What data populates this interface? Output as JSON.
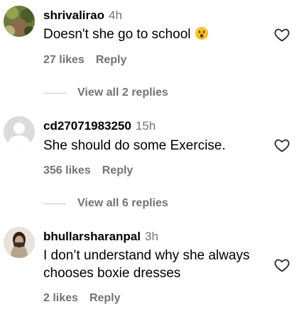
{
  "comments": [
    {
      "username": "shrivalirao",
      "time": "4h",
      "text": "Doesn't she go to school",
      "emoji": "astonished-face",
      "likes": "27 likes",
      "reply": "Reply",
      "view_replies": "View all 2 replies"
    },
    {
      "username": "cd27071983250",
      "time": "15h",
      "text": "She should do some Exercise.",
      "likes": "356 likes",
      "reply": "Reply",
      "view_replies": "View all 6 replies"
    },
    {
      "username": "bhullarsharanpal",
      "time": "3h",
      "text": "I don’t understand why she always chooses boxie dresses",
      "likes": "2 likes",
      "reply": "Reply"
    }
  ],
  "colors": {
    "secondary_text": "#737373",
    "divider": "#c7c7c7",
    "heart_outline": "#262626"
  },
  "icons": [
    "heart-outline-icon",
    "default-avatar-icon",
    "astonished-face-emoji"
  ]
}
